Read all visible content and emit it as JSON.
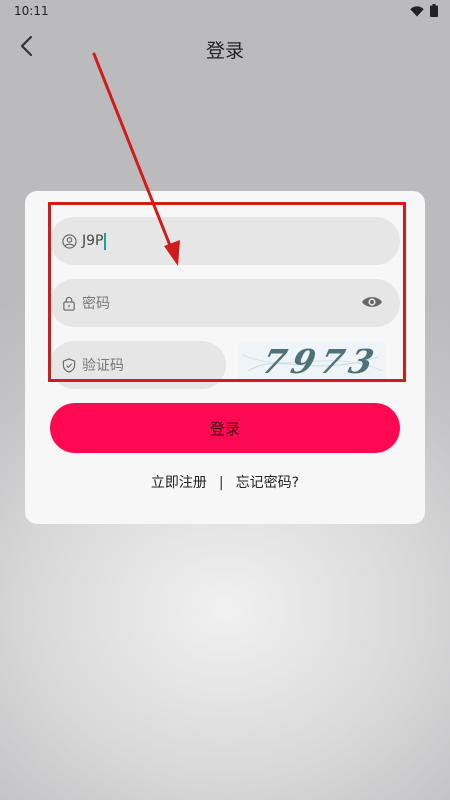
{
  "status_bar": {
    "time": "10:11",
    "icons": [
      "wifi-icon",
      "battery-icon"
    ]
  },
  "header": {
    "title": "登录",
    "back_icon": "chevron-left-icon"
  },
  "form": {
    "username": {
      "value": "J9P",
      "icon": "user-circle-icon"
    },
    "password": {
      "placeholder": "密码",
      "icon": "lock-icon",
      "toggle_icon": "eye-icon"
    },
    "captcha": {
      "placeholder": "验证码",
      "icon": "shield-icon",
      "image_text": "7973"
    },
    "login_label": "登录",
    "register_label": "立即注册",
    "separator": "|",
    "forgot_label": "忘记密码?"
  },
  "colors": {
    "accent": "#ff0a52",
    "highlight": "#d21b1b",
    "caret": "#1aa39a"
  }
}
